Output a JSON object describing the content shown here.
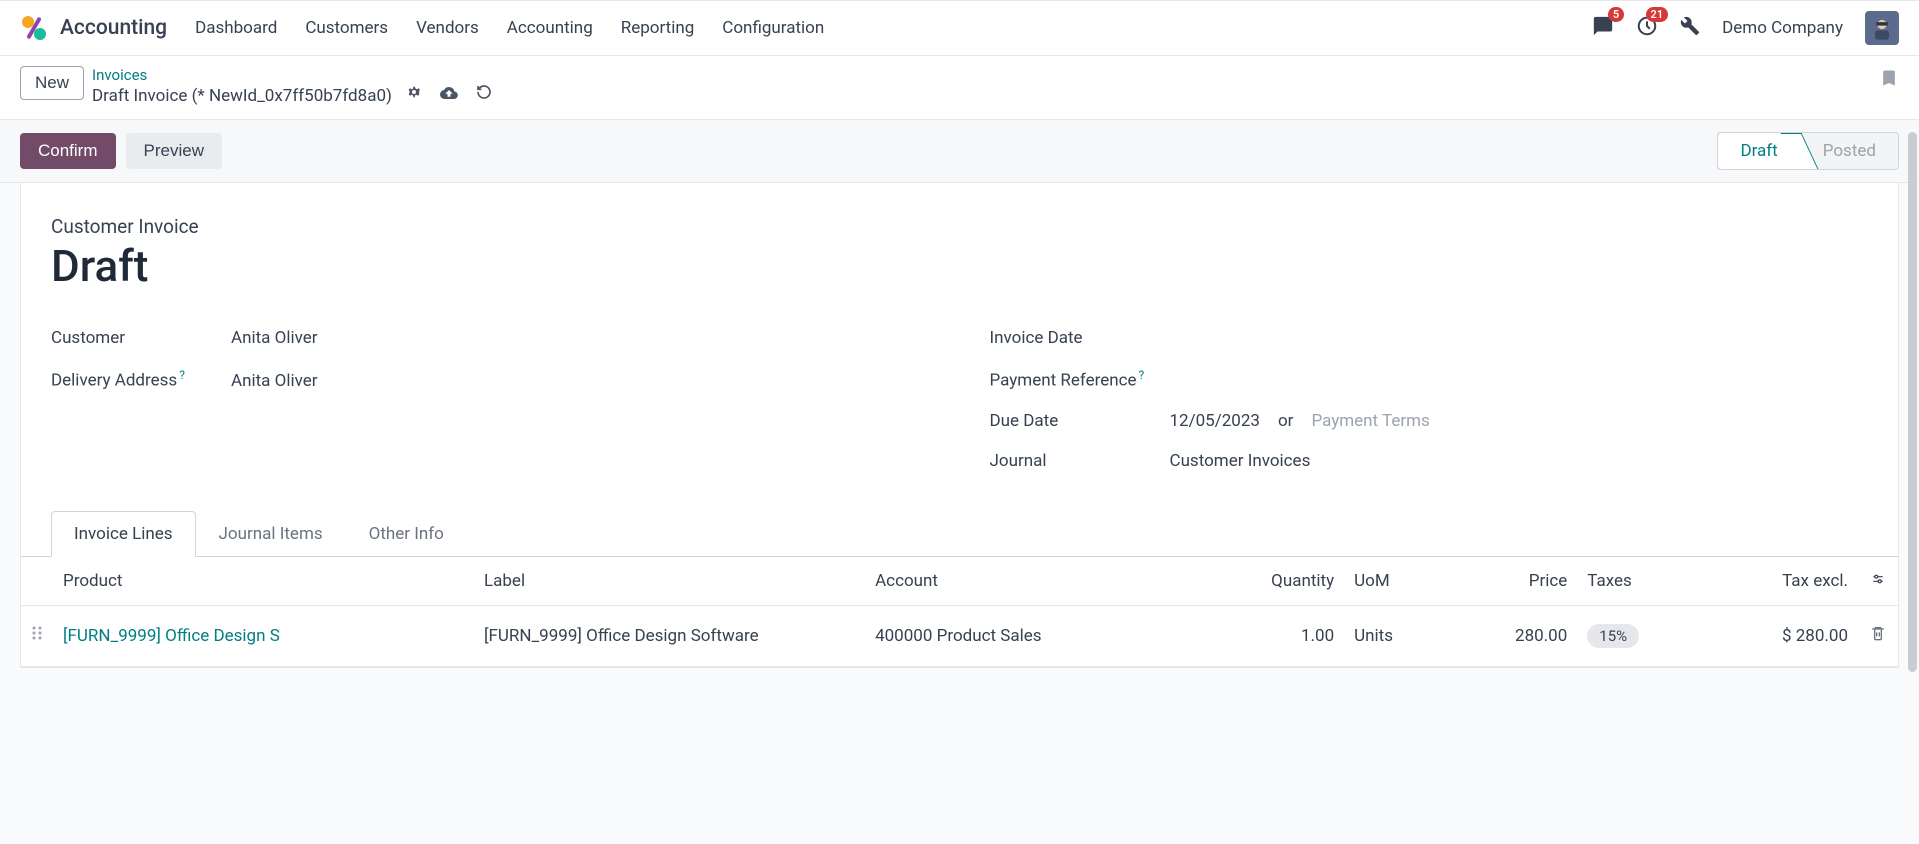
{
  "app": {
    "name": "Accounting"
  },
  "nav": {
    "items": [
      "Dashboard",
      "Customers",
      "Vendors",
      "Accounting",
      "Reporting",
      "Configuration"
    ]
  },
  "topbar": {
    "messages_badge": "5",
    "activities_badge": "21",
    "company": "Demo Company"
  },
  "breadcrumb": {
    "new_label": "New",
    "parent": "Invoices",
    "current": "Draft Invoice (* NewId_0x7ff50b7fd8a0)"
  },
  "actions": {
    "confirm": "Confirm",
    "preview": "Preview"
  },
  "status": {
    "draft": "Draft",
    "posted": "Posted"
  },
  "doc": {
    "type_label": "Customer Invoice",
    "title": "Draft"
  },
  "fields": {
    "customer_label": "Customer",
    "customer_value": "Anita Oliver",
    "delivery_label": "Delivery Address",
    "delivery_value": "Anita Oliver",
    "invoice_date_label": "Invoice Date",
    "invoice_date_value": "",
    "payment_ref_label": "Payment Reference",
    "payment_ref_value": "",
    "due_date_label": "Due Date",
    "due_date_value": "12/05/2023",
    "or_text": "or",
    "payment_terms_placeholder": "Payment Terms",
    "journal_label": "Journal",
    "journal_value": "Customer Invoices"
  },
  "tabs": {
    "invoice_lines": "Invoice Lines",
    "journal_items": "Journal Items",
    "other_info": "Other Info"
  },
  "table": {
    "headers": {
      "product": "Product",
      "label": "Label",
      "account": "Account",
      "quantity": "Quantity",
      "uom": "UoM",
      "price": "Price",
      "taxes": "Taxes",
      "tax_excl": "Tax excl."
    },
    "rows": [
      {
        "product": "[FURN_9999] Office Design S",
        "label": "[FURN_9999] Office Design Software",
        "account": "400000 Product Sales",
        "quantity": "1.00",
        "uom": "Units",
        "price": "280.00",
        "taxes": "15%",
        "tax_excl": "$ 280.00"
      }
    ]
  }
}
